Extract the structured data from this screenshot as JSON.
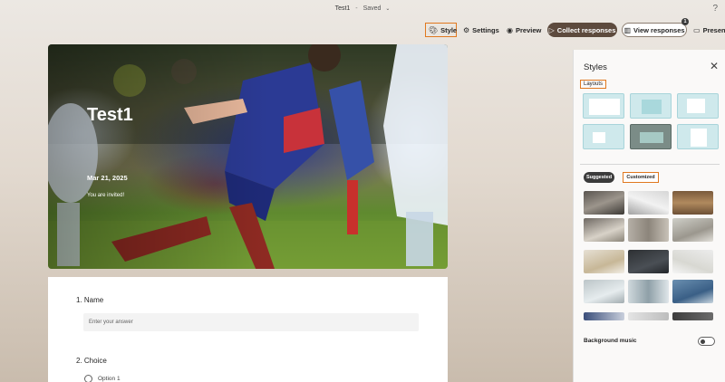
{
  "topbar": {
    "doc_title": "Test1",
    "separator": "-",
    "status": "Saved",
    "status_chevron": "⌄",
    "help": "?",
    "buttons": {
      "style": "Style",
      "settings": "Settings",
      "preview": "Preview",
      "collect": "Collect responses",
      "view": "View responses",
      "view_badge": "1",
      "present": "Present"
    },
    "icons": {
      "style": "palette-icon",
      "settings": "gear-icon",
      "preview": "eye-icon",
      "collect": "send-icon",
      "view": "chart-icon",
      "present": "monitor-icon"
    }
  },
  "hero": {
    "title": "Test1",
    "date": "Mar 21, 2025",
    "invite": "You are invited!"
  },
  "form": {
    "questions": [
      {
        "label": "1. Name",
        "placeholder": "Enter your answer"
      },
      {
        "label": "2. Choice",
        "options": [
          "Option 1"
        ]
      }
    ]
  },
  "styles_panel": {
    "title": "Styles",
    "close": "✕",
    "layouts_label": "Layouts",
    "tabs": {
      "suggested": "Suggested",
      "customized": "Customized"
    },
    "background_music": "Background music",
    "background_music_on": false,
    "selected_layout_index": 4
  },
  "colors": {
    "accent_highlight": "#e0781f",
    "collect_button": "#5d4a3d",
    "layout_tile": "#cfe9ec"
  }
}
